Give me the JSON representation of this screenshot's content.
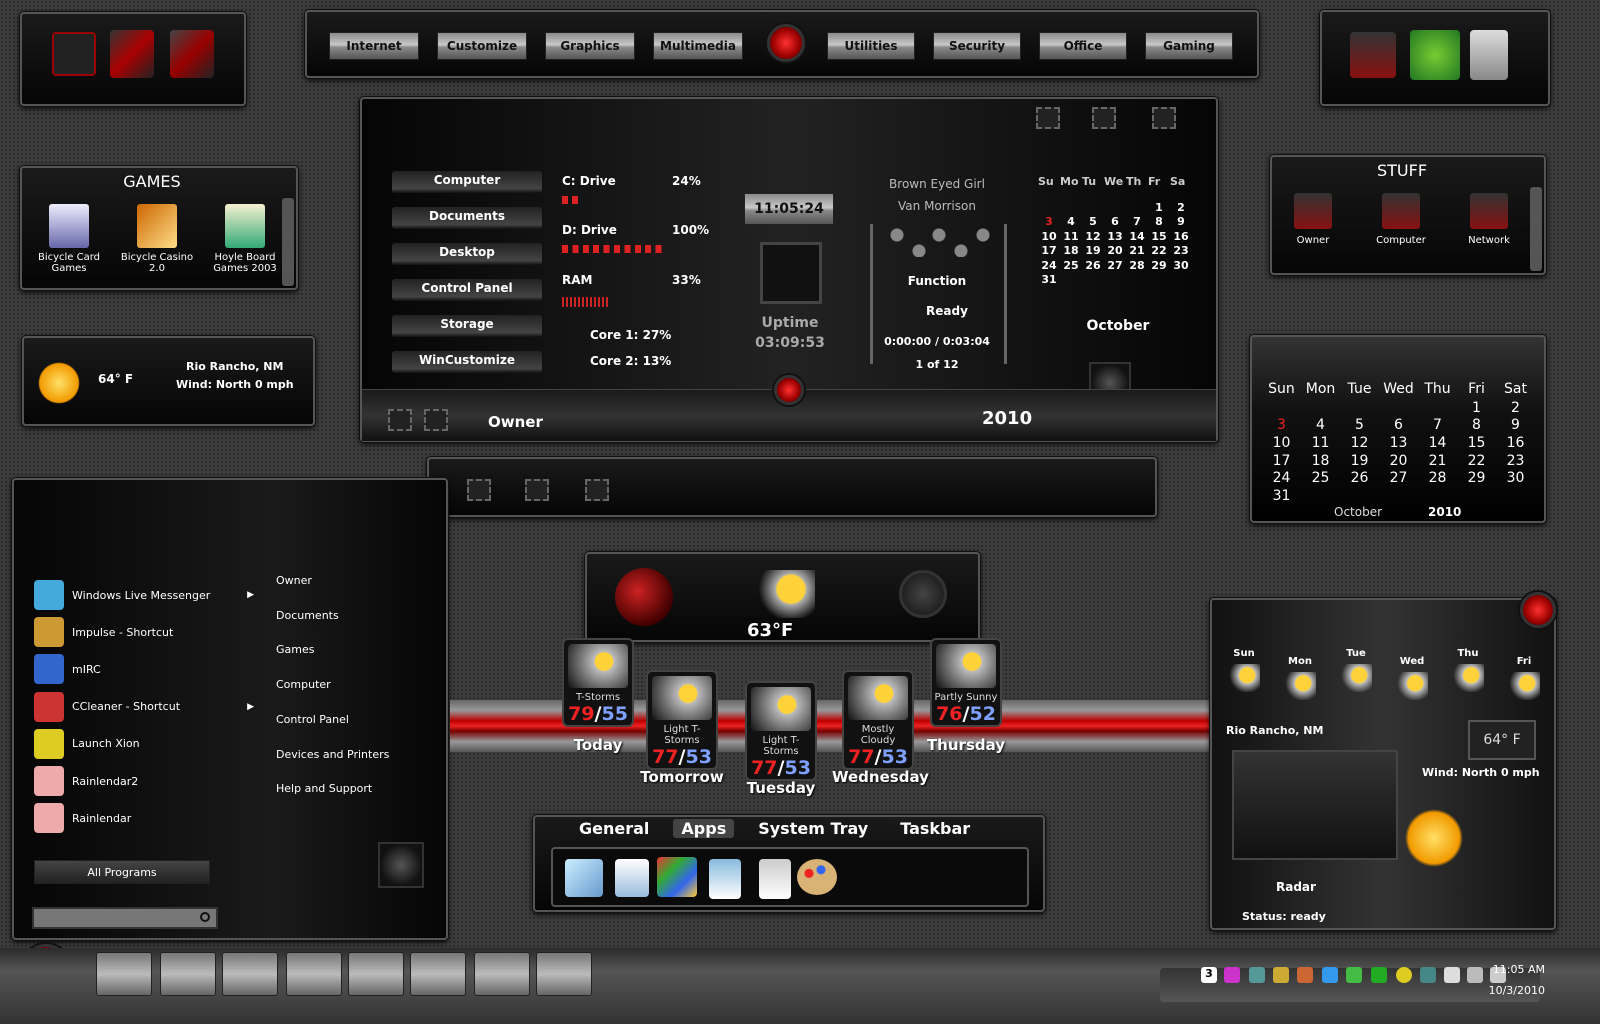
{
  "top_nav": {
    "left": [
      "Internet",
      "Customize",
      "Graphics",
      "Multimedia"
    ],
    "right": [
      "Utilities",
      "Security",
      "Office",
      "Gaming"
    ]
  },
  "games": {
    "title": "GAMES",
    "items": [
      {
        "label": "Bicycle Card Games"
      },
      {
        "label": "Bicycle Casino 2.0"
      },
      {
        "label": "Hoyle Board Games 2003"
      }
    ]
  },
  "stuff": {
    "title": "STUFF",
    "items": [
      "Owner",
      "Computer",
      "Network"
    ]
  },
  "main": {
    "nav": [
      "Computer",
      "Documents",
      "Desktop",
      "Control Panel",
      "Storage",
      "WinCustomize"
    ],
    "c_drive": {
      "label": "C: Drive",
      "value": "24%"
    },
    "d_drive": {
      "label": "D: Drive",
      "value": "100%"
    },
    "ram": {
      "label": "RAM",
      "value": "33%"
    },
    "core1": "Core 1:  27%",
    "core2": "Core 2:  13%",
    "clock": "11:05:24",
    "uptime_label": "Uptime",
    "uptime": "03:09:53",
    "song": "Brown Eyed Girl",
    "artist": "Van Morrison",
    "function": "Function",
    "status": "Ready",
    "time": "0:00:00 / 0:03:04",
    "track": "1 of 12",
    "cal_head": [
      "Su",
      "Mo",
      "Tu",
      "We",
      "Th",
      "Fr",
      "Sa"
    ],
    "cal_rows": [
      [
        "",
        "",
        "",
        "",
        "",
        "1",
        "2"
      ],
      [
        "3",
        "4",
        "5",
        "6",
        "7",
        "8",
        "9"
      ],
      [
        "10",
        "11",
        "12",
        "13",
        "14",
        "15",
        "16"
      ],
      [
        "17",
        "18",
        "19",
        "20",
        "21",
        "22",
        "23"
      ],
      [
        "24",
        "25",
        "26",
        "27",
        "28",
        "29",
        "30"
      ],
      [
        "31",
        "",
        "",
        "",
        "",
        "",
        ""
      ]
    ],
    "month": "October",
    "user": "Owner",
    "year": "2010"
  },
  "weather_small": {
    "temp": "64° F",
    "city": "Rio Rancho, NM",
    "wind": "Wind: North 0 mph"
  },
  "calendar_right": {
    "head": [
      "Sun",
      "Mon",
      "Tue",
      "Wed",
      "Thu",
      "Fri",
      "Sat"
    ],
    "month": "October",
    "year": "2010",
    "today": "3"
  },
  "start_menu": {
    "programs": [
      {
        "label": "Windows Live Messenger",
        "arrow": true
      },
      {
        "label": "Impulse - Shortcut"
      },
      {
        "label": "mIRC"
      },
      {
        "label": "CCleaner - Shortcut",
        "arrow": true
      },
      {
        "label": "Launch Xion"
      },
      {
        "label": "Rainlendar2"
      },
      {
        "label": "Rainlendar"
      }
    ],
    "links": [
      "Owner",
      "Documents",
      "Games",
      "Computer",
      "Control Panel",
      "Devices and Printers",
      "Help and Support"
    ],
    "all_programs": "All Programs",
    "search_placeholder": ""
  },
  "weather_center": {
    "temp": "63°F",
    "forecast": [
      {
        "day": "Today",
        "cond": "T-Storms",
        "hi": "79",
        "lo": "55"
      },
      {
        "day": "Tomorrow",
        "cond": "Light T-Storms",
        "hi": "77",
        "lo": "53"
      },
      {
        "day": "Tuesday",
        "cond": "Light T-Storms",
        "hi": "77",
        "lo": "53"
      },
      {
        "day": "Wednesday",
        "cond": "Mostly Cloudy",
        "hi": "77",
        "lo": "53"
      },
      {
        "day": "Thursday",
        "cond": "Partly Sunny",
        "hi": "76",
        "lo": "52"
      }
    ]
  },
  "dock": {
    "tabs": [
      "General",
      "Apps",
      "System Tray",
      "Taskbar"
    ],
    "active": "Apps"
  },
  "weather_right": {
    "days": [
      "Sun",
      "Mon",
      "Tue",
      "Wed",
      "Thu",
      "Fri"
    ],
    "city": "Rio Rancho, NM",
    "temp": "64° F",
    "wind": "Wind: North 0 mph",
    "radar": "Radar",
    "status": "Status: ready"
  },
  "taskbar": {
    "time": "11:05 AM",
    "date": "10/3/2010",
    "calendar_badge": "3"
  },
  "colors": {
    "accent": "#e01818",
    "low_temp": "#7fa0ff"
  }
}
